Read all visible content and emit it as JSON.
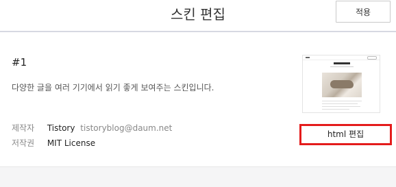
{
  "header": {
    "title": "스킨 편집",
    "apply_label": "적용"
  },
  "skin": {
    "number": "#1",
    "description": "다양한 글을 여러 기기에서 읽기 좋게 보여주는 스킨입니다.",
    "author_label": "제작자",
    "author_name": "Tistory",
    "author_email": "tistoryblog@daum.net",
    "license_label": "저작권",
    "license_value": "MIT License",
    "edit_label": "html 편집"
  },
  "colors": {
    "highlight_border": "#e41b1b",
    "header_border": "#d6d8e2"
  }
}
